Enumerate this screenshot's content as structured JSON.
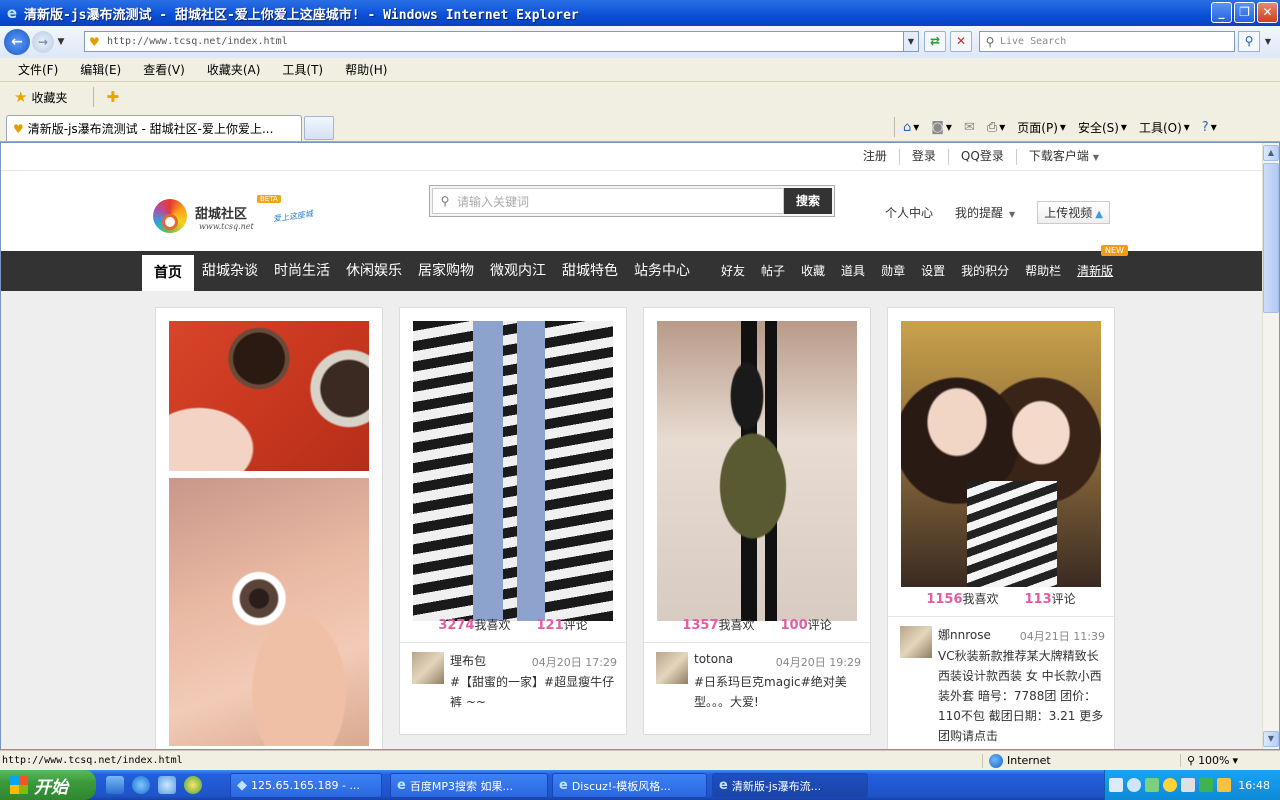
{
  "window": {
    "title": "清新版-js瀑布流测试 - 甜城社区-爱上你爱上这座城市! - Windows Internet Explorer"
  },
  "browser": {
    "url": "http://www.tcsq.net/index.html",
    "search_placeholder": "Live Search",
    "menu": [
      "文件(F)",
      "编辑(E)",
      "查看(V)",
      "收藏夹(A)",
      "工具(T)",
      "帮助(H)"
    ],
    "favorites_label": "收藏夹",
    "tab_title": "清新版-js瀑布流测试 - 甜城社区-爱上你爱上...",
    "commands": {
      "page": "页面(P)",
      "safety": "安全(S)",
      "tools": "工具(O)"
    }
  },
  "site": {
    "top_links": [
      "注册",
      "登录",
      "QQ登录",
      "下载客户端"
    ],
    "logo": {
      "name": "甜城社区",
      "badge": "BETA",
      "url": "www.tcsq.net",
      "slogan": "爱上这座城"
    },
    "search_placeholder": "请输入关键词",
    "search_button": "搜索",
    "header_links": {
      "personal": "个人中心",
      "reminders": "我的提醒",
      "upload": "上传视频"
    },
    "nav_main": [
      "首页",
      "甜城杂谈",
      "时尚生活",
      "休闲娱乐",
      "居家购物",
      "微观内江",
      "甜城特色",
      "站务中心"
    ],
    "nav_sub": [
      "好友",
      "帖子",
      "收藏",
      "道具",
      "勋章",
      "设置",
      "我的积分",
      "帮助栏",
      "清新版"
    ],
    "new_badge": "NEW"
  },
  "cards": [
    {
      "likes": "3274",
      "likes_label": "我喜欢",
      "comments": "121",
      "comments_label": "评论",
      "user": "理布包",
      "time": "04月20日 17:29",
      "text": "#【甜蜜的一家】#超显瘦牛仔裤 ~~"
    },
    {
      "likes": "1357",
      "likes_label": "我喜欢",
      "comments": "100",
      "comments_label": "评论",
      "user": "totona",
      "time": "04月20日 19:29",
      "text": "#日系玛巨克magic#绝对美型。。。大爱!"
    },
    {
      "likes": "1156",
      "likes_label": "我喜欢",
      "comments": "113",
      "comments_label": "评论",
      "user": "娜nnrose",
      "time": "04月21日 11:39",
      "text": "VC秋装新款推荐某大牌精致长西装设计款西装 女 中长款小西装外套 暗号：7788团 团价：110不包 截团日期：3.21 更多团购请点击"
    }
  ],
  "statusbar": {
    "url": "http://www.tcsq.net/index.html",
    "zone": "Internet",
    "zoom": "100%"
  },
  "taskbar": {
    "start": "开始",
    "tasks": [
      "125.65.165.189 - ...",
      "百度MP3搜索 如果...",
      "Discuz!-模板风格...",
      "清新版-js瀑布流..."
    ],
    "clock": "16:48"
  }
}
